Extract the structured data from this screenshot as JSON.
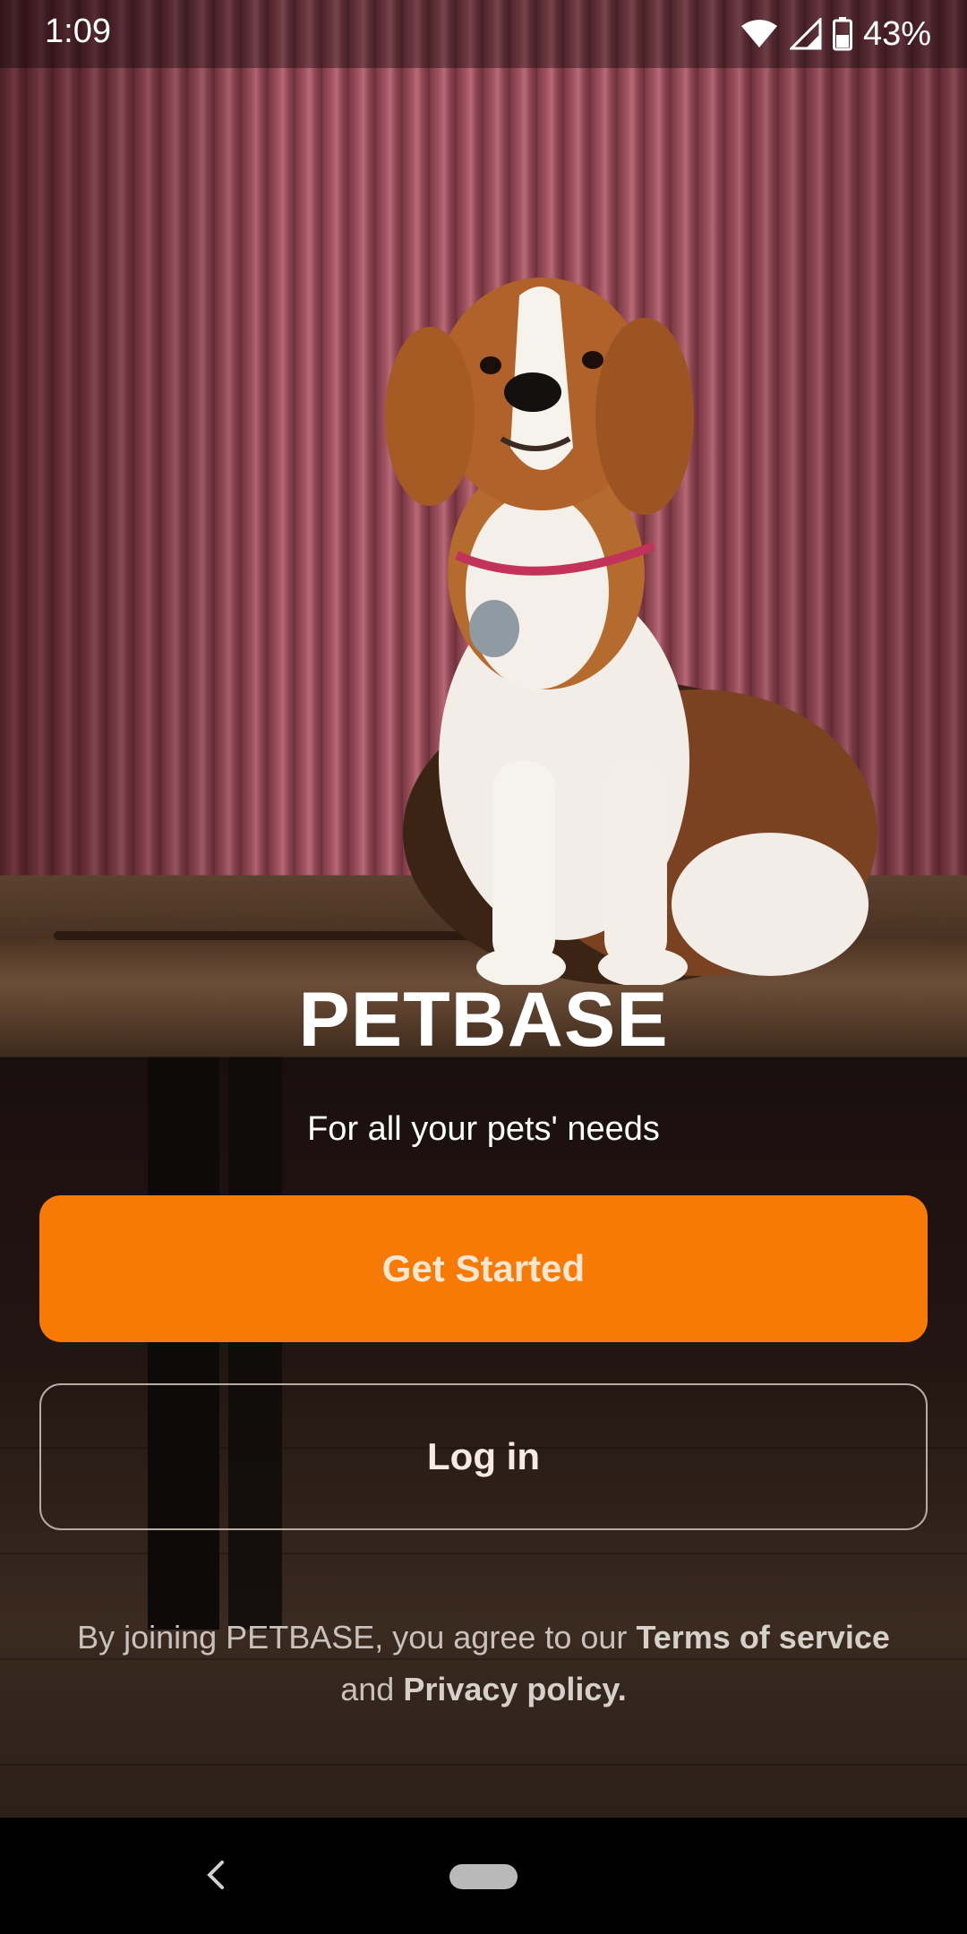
{
  "status_bar": {
    "time": "1:09",
    "battery": "43%",
    "icons": [
      "wifi-icon",
      "cell-signal-icon",
      "battery-icon"
    ]
  },
  "brand": {
    "title": "PETBASE",
    "tagline": "For all your pets' needs"
  },
  "actions": {
    "get_started": "Get Started",
    "log_in": "Log in"
  },
  "legal": {
    "prefix": "By joining PETBASE, you agree to our",
    "terms": "Terms of service",
    "and": "and",
    "privacy": "Privacy policy."
  },
  "colors": {
    "primary": "#f77a06",
    "outline": "#b8aba0"
  },
  "nav": {
    "icons": [
      "back-icon",
      "home-pill-icon"
    ]
  }
}
